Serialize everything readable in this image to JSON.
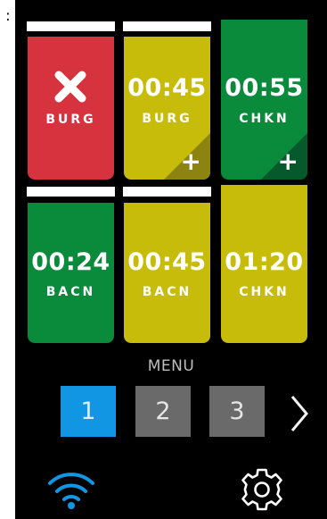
{
  "header": {
    "prefix": ":"
  },
  "tiles": [
    {
      "status": "cancelled",
      "time": "",
      "item": "BURG",
      "color": "red",
      "action": ""
    },
    {
      "status": "active",
      "time": "00:45",
      "item": "BURG",
      "color": "yellow",
      "action": "+"
    },
    {
      "status": "active",
      "time": "00:55",
      "item": "CHKN",
      "color": "green",
      "action": "+"
    },
    {
      "status": "active",
      "time": "00:24",
      "item": "BACN",
      "color": "green",
      "action": ""
    },
    {
      "status": "active",
      "time": "00:45",
      "item": "BACN",
      "color": "yellow",
      "action": ""
    },
    {
      "status": "active",
      "time": "01:20",
      "item": "CHKN",
      "color": "yellow",
      "action": ""
    }
  ],
  "menu": {
    "label": "MENU",
    "pages": [
      "1",
      "2",
      "3"
    ],
    "active_page": "1",
    "next_icon": "chevron-right-icon"
  },
  "footer": {
    "wifi_icon": "wifi-icon",
    "settings_icon": "gear-icon"
  },
  "colors": {
    "red": "#d6333f",
    "yellow": "#c8bc0a",
    "green": "#0a8a3b",
    "active_page": "#1196e4",
    "wifi": "#1196e4"
  }
}
